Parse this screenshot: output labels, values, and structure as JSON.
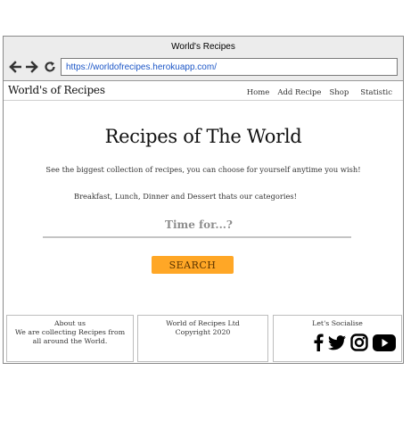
{
  "browser": {
    "title": "World's Recipes",
    "url": "https://worldofrecipes.herokuapp.com/",
    "icons": [
      "back-arrow-icon",
      "forward-arrow-icon",
      "refresh-icon"
    ]
  },
  "header": {
    "logo": "World's of Recipes",
    "nav": [
      "Home",
      "Add Recipe",
      "Shop",
      "Statistic"
    ]
  },
  "hero": {
    "title": "Recipes of The World",
    "lead1": "See the biggest collection of recipes, you can choose for yourself anytime you wish!",
    "lead2": "Breakfast, Lunch, Dinner and Dessert thats our categories!",
    "search_placeholder": "Time for...?",
    "search_button": "SEARCH"
  },
  "footer": {
    "about_title": "About us",
    "about_text": "We are collecting Recipes from all around the World.",
    "company": "World of Recipes Ltd",
    "copyright": "Copyright 2020",
    "social_title": "Let's Socialise",
    "social_icons": [
      "facebook-icon",
      "twitter-icon",
      "instagram-icon",
      "youtube-icon"
    ]
  },
  "colors": {
    "accent": "#ffa726",
    "url_text": "#1c56c7"
  }
}
